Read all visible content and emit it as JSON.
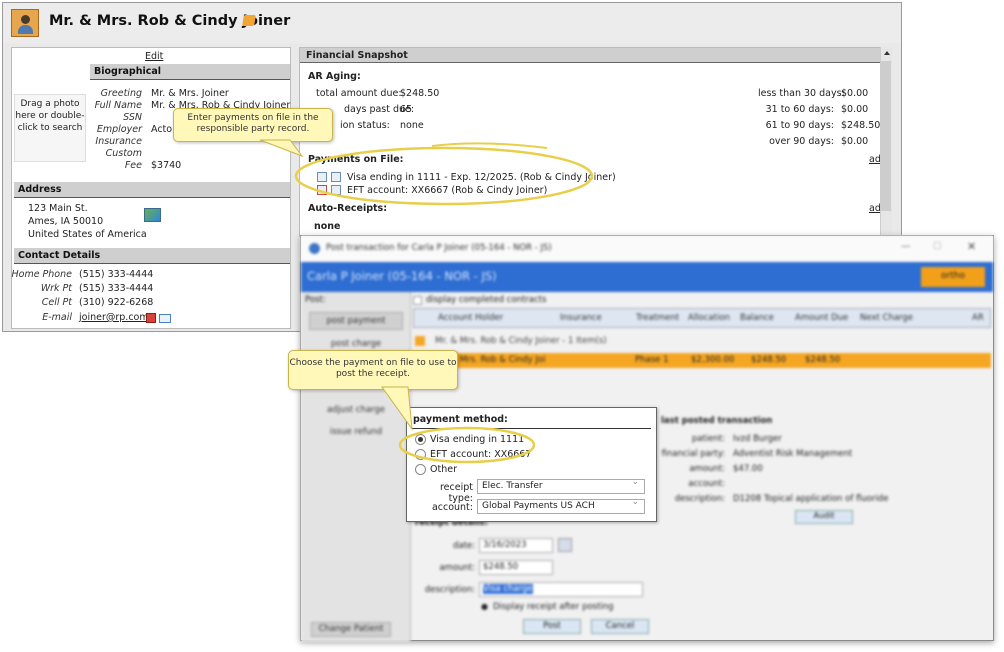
{
  "header": {
    "patient_name": "Mr. & Mrs. Rob & Cindy Joiner"
  },
  "left_panel": {
    "edit_label": "Edit",
    "biographical_title": "Biographical",
    "photo_hint": "Drag a photo here or double-click to search",
    "fields": [
      {
        "label": "Greeting",
        "value": "Mr. & Mrs. Joiner"
      },
      {
        "label": "Full Name",
        "value": "Mr. & Mrs. Rob & Cindy Joiner"
      },
      {
        "label": "SSN",
        "value": ""
      },
      {
        "label": "Employer",
        "value": "Actor"
      },
      {
        "label": "Insurance",
        "value": ""
      },
      {
        "label": "Custom",
        "value": ""
      },
      {
        "label": "Fee",
        "value": "$3740"
      }
    ],
    "address_title": "Address",
    "address_lines": [
      "123 Main St.",
      "Ames, IA 50010",
      "United States of America"
    ],
    "contact_title": "Contact Details",
    "contacts": [
      {
        "label": "Home Phone",
        "value": "(515) 333-4444"
      },
      {
        "label": "Wrk Pt",
        "value": "(515) 333-4444"
      },
      {
        "label": "Cell Pt",
        "value": "(310) 922-6268"
      },
      {
        "label": "E-mail",
        "value": "joiner@rp.com"
      }
    ]
  },
  "financial": {
    "title": "Financial Snapshot",
    "ar_aging_title": "AR Aging:",
    "total_amount_label": "total amount due:",
    "total_amount_value": "$248.50",
    "days_past_label": "days past due:",
    "days_past_value": "65",
    "collection_label": "ion status:",
    "collection_value": "none",
    "aging": [
      {
        "label": "less than 30 days:",
        "value": "$0.00"
      },
      {
        "label": "31 to 60 days:",
        "value": "$0.00"
      },
      {
        "label": "61 to 90 days:",
        "value": "$248.50"
      },
      {
        "label": "over 90 days:",
        "value": "$0.00"
      }
    ],
    "payments_title": "Payments on File:",
    "payments": [
      "Visa ending in 1111 - Exp. 12/2025. (Rob & Cindy Joiner)",
      "EFT account: XX6667 (Rob & Cindy Joiner)"
    ],
    "add_label": "add",
    "auto_receipts_title": "Auto-Receipts:",
    "auto_receipts_value": "none"
  },
  "callouts": {
    "top": "Enter payments on file in the responsible party record.",
    "bottom": "Choose the payment on file to use to post the receipt."
  },
  "post_window": {
    "title": "Post transaction for Carla P Joiner (05-164 - NOR - JS)",
    "patient_bar": "Carla P Joiner (05-164 - NOR - JS)",
    "pay_to_label": "ortho",
    "post_label": "Post:",
    "side_items": [
      "post payment",
      "post charge",
      "adjust charge",
      "issue refund"
    ],
    "change_patient": "Change Patient",
    "display_completed": "display completed contracts",
    "columns": [
      "Account Holder",
      "Insurance",
      "Treatment",
      "Allocation",
      "Balance",
      "Amount Due",
      "Next Charge",
      "AR"
    ],
    "group_row": "Mr. & Mrs. Rob & Cindy Joiner - 1 Item(s)",
    "row": {
      "holder": "Mr. & Mrs. Rob & Cindy Joi",
      "treatment": "Phase 1",
      "allocation": "$2,300.00",
      "balance": "$248.50",
      "amount_due": "$248.50"
    },
    "last_posted_title": "last posted transaction",
    "last_posted": [
      {
        "label": "patient:",
        "value": "Ivzd Burger"
      },
      {
        "label": "financial party:",
        "value": "Adventist Risk Management"
      },
      {
        "label": "amount:",
        "value": "$47.00"
      },
      {
        "label": "account:",
        "value": ""
      },
      {
        "label": "description:",
        "value": "D1208 Topical application of fluoride"
      }
    ],
    "audit_label": "Audit",
    "receipt_details": "receipt details:",
    "date_label": "date:",
    "date_value": "3/16/2023",
    "amount_label": "amount:",
    "amount_value": "$248.50",
    "description_label": "description:",
    "description_value": "Visa charge",
    "display_receipt": "Display receipt after posting",
    "post_button": "Post",
    "cancel_button": "Cancel"
  },
  "payment_method": {
    "title": "payment method:",
    "options": [
      "Visa ending in 1111",
      "EFT account: XX6667",
      "Other"
    ],
    "selected": "Visa ending in 1111",
    "receipt_type_label": "receipt type:",
    "receipt_type_value": "Elec. Transfer",
    "account_label": "account:",
    "account_value": "Global Payments US ACH"
  }
}
